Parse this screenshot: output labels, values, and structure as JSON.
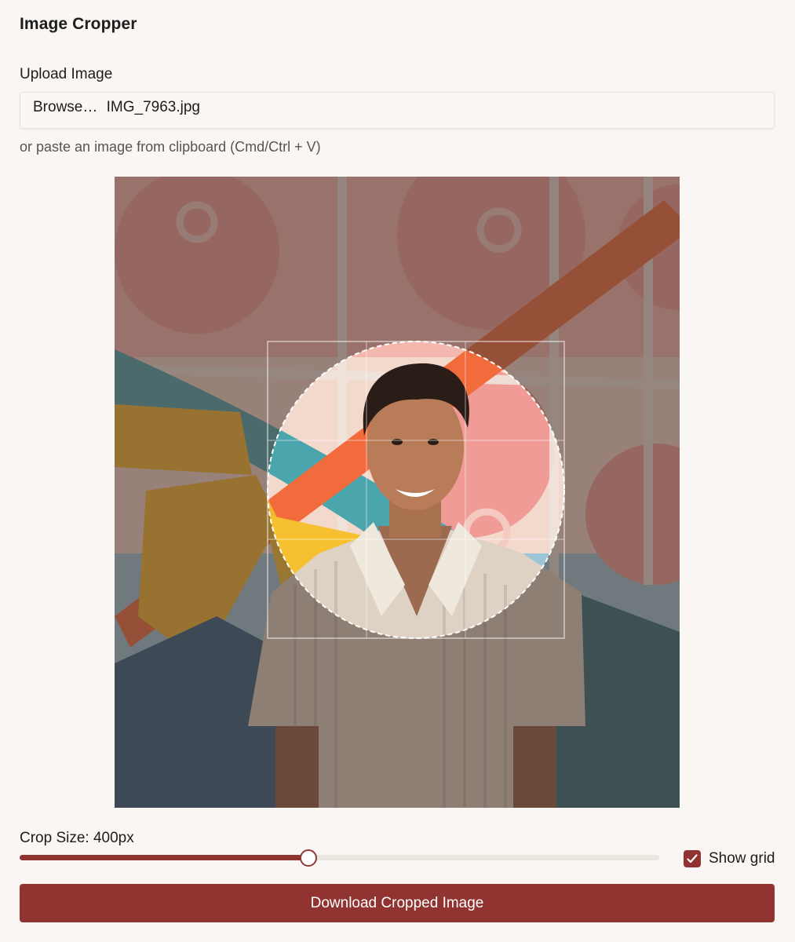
{
  "app": {
    "title": "Image Cropper"
  },
  "upload": {
    "label": "Upload Image",
    "browse_label": "Browse…",
    "file_name": "IMG_7963.jpg",
    "paste_hint": "or paste an image from clipboard (Cmd/Ctrl + V)"
  },
  "crop": {
    "label": "Crop Size: 400px",
    "slider_fraction": 0.452,
    "shape": "circle",
    "overlay": "dimmed outside crop area"
  },
  "grid_toggle": {
    "label": "Show grid",
    "checked": true
  },
  "download_button": {
    "label": "Download Cropped Image"
  },
  "colors": {
    "accent": "#913431",
    "background": "#faf6f3",
    "slider_track": "#ece6e1",
    "muted_text": "#555555"
  }
}
